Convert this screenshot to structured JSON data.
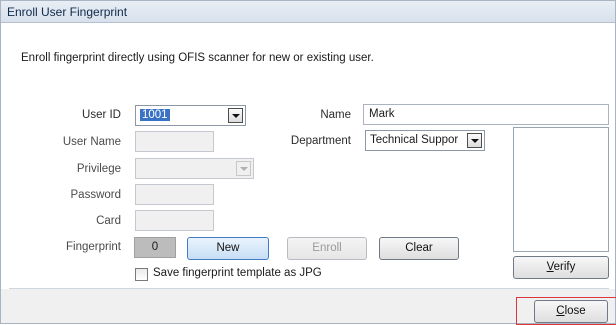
{
  "window": {
    "title": "Enroll User Fingerprint"
  },
  "description": "Enroll fingerprint directly using OFIS scanner for new or existing user.",
  "form": {
    "user_id_label": "User ID",
    "user_id_value": "1001",
    "user_name_label": "User Name",
    "user_name_value": "",
    "privilege_label": "Privilege",
    "privilege_value": "",
    "password_label": "Password",
    "password_value": "",
    "card_label": "Card",
    "card_value": "",
    "fingerprint_label": "Fingerprint",
    "fingerprint_count": "0",
    "name_label": "Name",
    "name_value": "Mark",
    "department_label": "Department",
    "department_value": "Technical Suppor"
  },
  "buttons": {
    "new": "New",
    "enroll": "Enroll",
    "clear": "Clear",
    "verify_rest": "erify",
    "verify_mnemonic": "V",
    "close_rest": "lose",
    "close_mnemonic": "C"
  },
  "checkbox": {
    "save_jpg_label": "Save fingerprint template as JPG",
    "checked": false
  },
  "colors": {
    "titlebar": "#dfe6f0",
    "selection": "#3a73c6",
    "highlight_border": "#d9363e"
  }
}
